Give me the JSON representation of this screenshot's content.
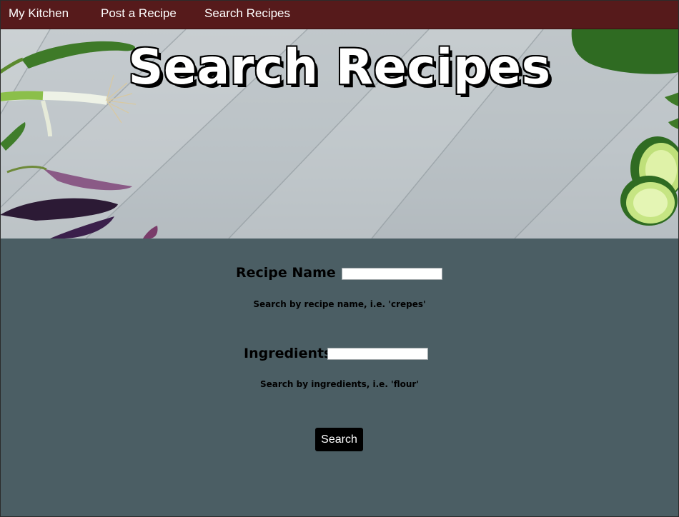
{
  "nav": {
    "items": [
      {
        "label": "My Kitchen"
      },
      {
        "label": "Post a Recipe"
      },
      {
        "label": "Search Recipes"
      }
    ]
  },
  "hero": {
    "title": "Search Recipes"
  },
  "form": {
    "recipe_name": {
      "label": "Recipe Name",
      "value": "",
      "hint": "Search by recipe name, i.e. 'crepes'"
    },
    "ingredients": {
      "label": "Ingredients",
      "value": "",
      "hint": "Search by ingredients, i.e. 'flour'"
    },
    "submit_label": "Search"
  },
  "colors": {
    "nav_bg": "#561a1b",
    "page_bg": "#4b5e64",
    "button_bg": "#000000"
  }
}
